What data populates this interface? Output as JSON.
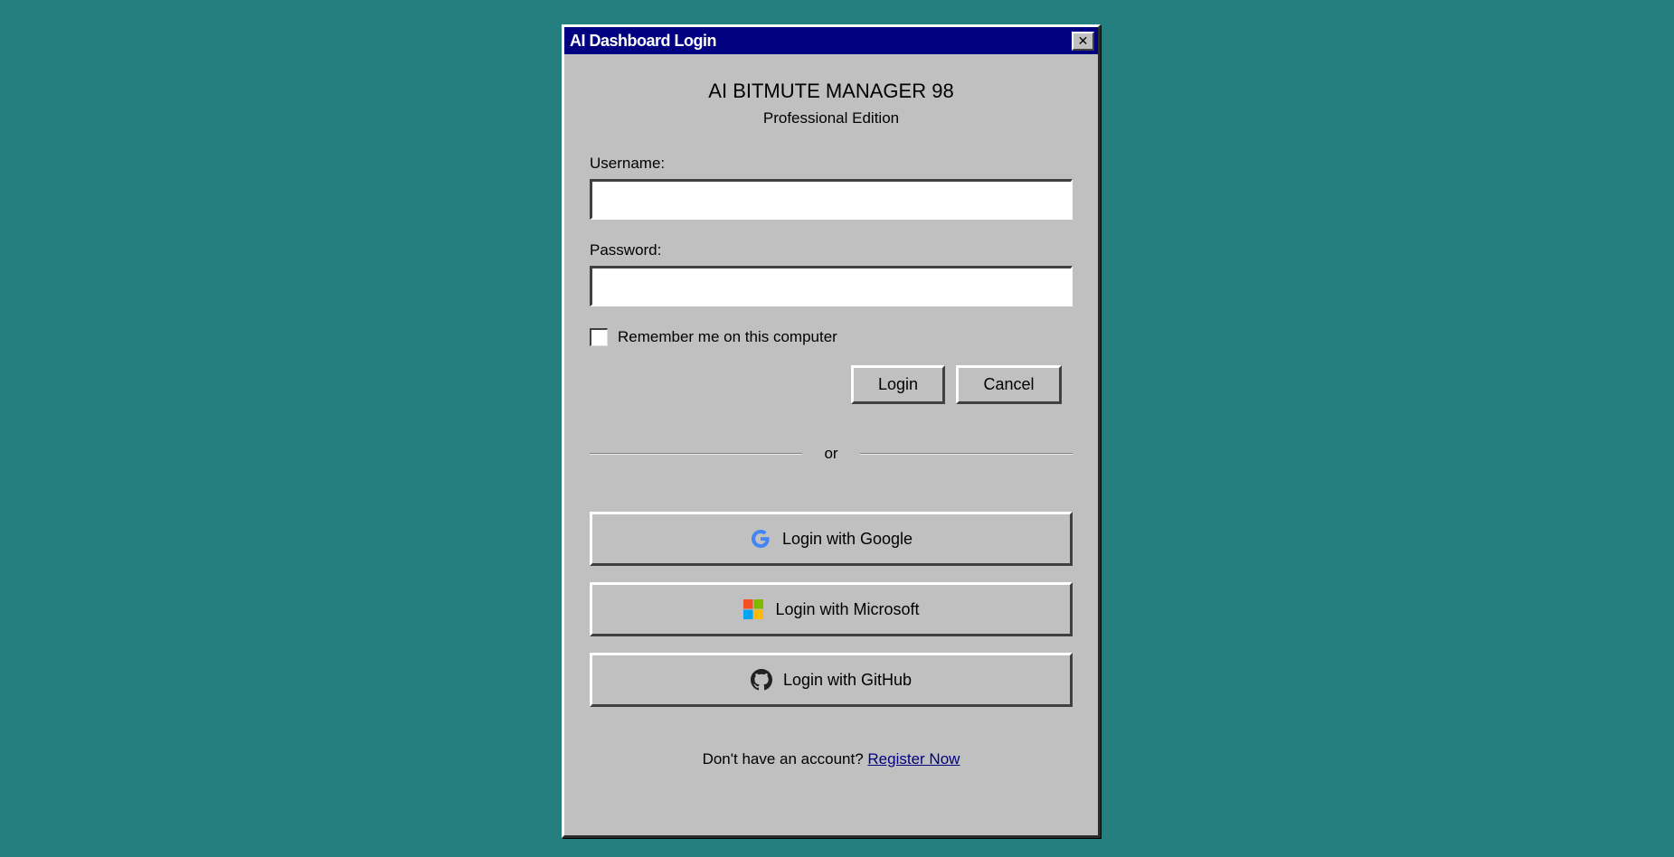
{
  "window": {
    "title": "AI Dashboard Login",
    "close_label": "✕"
  },
  "header": {
    "app_title": "AI BITMUTE MANAGER 98",
    "app_subtitle": "Professional Edition"
  },
  "form": {
    "username_label": "Username:",
    "username_value": "",
    "password_label": "Password:",
    "password_value": "",
    "remember_label": "Remember me on this computer",
    "remember_checked": false,
    "login_label": "Login",
    "cancel_label": "Cancel"
  },
  "divider": {
    "text": "or"
  },
  "social": [
    {
      "label": "Login with Google",
      "icon": "google-icon"
    },
    {
      "label": "Login with Microsoft",
      "icon": "microsoft-icon"
    },
    {
      "label": "Login with GitHub",
      "icon": "github-icon"
    }
  ],
  "footer": {
    "prompt": "Don't have an account?",
    "link_label": "Register Now"
  },
  "colors": {
    "desktop": "#257f7f",
    "window_face": "#c0c0c0",
    "titlebar": "#000080",
    "link": "#000080"
  }
}
